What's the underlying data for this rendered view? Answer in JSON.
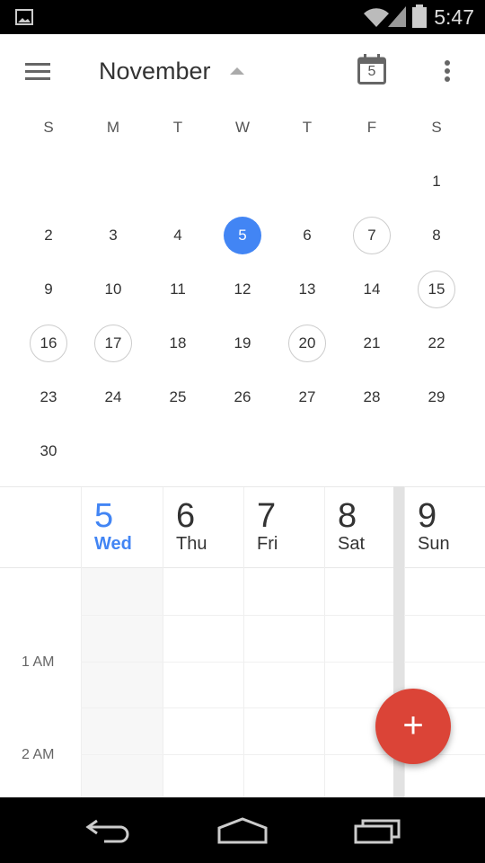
{
  "status_bar": {
    "time": "5:47"
  },
  "toolbar": {
    "month": "November",
    "today_icon_day": "5"
  },
  "colors": {
    "accent": "#4285f4",
    "fab": "#db4437"
  },
  "month": {
    "weekdays": [
      "S",
      "M",
      "T",
      "W",
      "T",
      "F",
      "S"
    ],
    "first_weekday": 6,
    "days_in_month": 30,
    "today": 5,
    "marked_days": [
      7,
      15,
      16,
      17,
      20
    ]
  },
  "week": {
    "days": [
      {
        "num": "5",
        "name": "Wed",
        "today": true
      },
      {
        "num": "6",
        "name": "Thu"
      },
      {
        "num": "7",
        "name": "Fri"
      },
      {
        "num": "8",
        "name": "Sat"
      },
      {
        "num": "9",
        "name": "Sun"
      }
    ],
    "hours": [
      "1 AM",
      "2 AM"
    ]
  },
  "fab": {
    "label": "+"
  }
}
